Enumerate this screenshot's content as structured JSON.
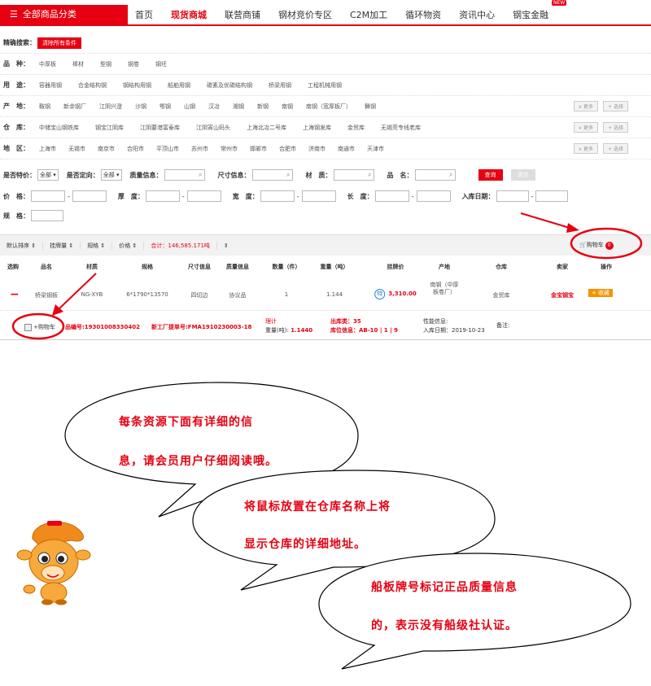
{
  "nav": {
    "category_label": "全部商品分类",
    "items": [
      "首页",
      "现货商城",
      "联营商铺",
      "钢材竞价专区",
      "C2M加工",
      "循环物资",
      "资讯中心",
      "钢宝金融"
    ],
    "active_index": 1,
    "new_badge": "NEW"
  },
  "filters": {
    "precise_search_label": "精确搜索：",
    "clear_label": "清除所有条件",
    "rows": [
      {
        "label": "品　种：",
        "first": "中厚板",
        "options": [
          "棒材",
          "型钢",
          "钢卷",
          "钢坯"
        ],
        "more": false
      },
      {
        "label": "用　途：",
        "first": "容器用钢",
        "options": [
          "合金结构钢",
          "钢结构用钢",
          "船舶用钢",
          "碳素及优碳结构钢",
          "桥梁用钢",
          "工程机械用钢"
        ],
        "more": false
      },
      {
        "label": "产　地：",
        "first": "鞍钢",
        "options": [
          "新余钢厂",
          "江阴兴澄",
          "沙钢",
          "鄂钢",
          "山钢",
          "汉冶",
          "湘钢",
          "新钢",
          "南钢",
          "南钢（宽厚板厂）",
          "舞钢"
        ],
        "more": true
      },
      {
        "label": "仓　库：",
        "first": "中储宝山钢铁库",
        "options": [
          "钢宝江阴库",
          "江阴要港富泰库",
          "江阴宵山码头",
          "上海北冶二号库",
          "上海钢发库",
          "金贸库",
          "无锡亮专线老库"
        ],
        "more": true
      },
      {
        "label": "地　区：",
        "first": "上海市",
        "options": [
          "无锡市",
          "南京市",
          "合阳市",
          "平顶山市",
          "苏州市",
          "常州市",
          "邯郸市",
          "合肥市",
          "济南市",
          "南通市",
          "天津市"
        ],
        "more": true
      }
    ],
    "more_label": "∨ 更多",
    "multi_label": "+ 选择"
  },
  "search": {
    "special_price_label": "是否特价：",
    "special_price_value": "全部",
    "directed_label": "是否定向：",
    "directed_value": "全部",
    "quality_label": "质量信息：",
    "size_label": "尺寸信息：",
    "material_label": "材　质：",
    "name_label": "品　名：",
    "query_label": "查询",
    "reset_label": "清空",
    "price_label": "价　格：",
    "thickness_label": "厚　度：",
    "width_label": "宽　度：",
    "length_label": "长　度：",
    "date_label": "入库日期：",
    "spec_label": "规　格："
  },
  "sort_bar": {
    "items": [
      "默认排序 ⇕",
      "挂牌量 ⇕",
      "规格 ⇕",
      "价格 ⇕"
    ],
    "total": "合计：146,585.171吨",
    "last": "⇕",
    "cart_label": "购物车",
    "cart_count": "0"
  },
  "table": {
    "headers": [
      "选购",
      "品名",
      "材质",
      "规格",
      "尺寸信息",
      "质量信息",
      "数量（件）",
      "重量（吨）",
      "挂牌价",
      "产地",
      "仓库",
      "卖家",
      "操作"
    ],
    "row": {
      "name": "桥梁钢板",
      "material": "NG-XYB",
      "spec": "6*1790*13570",
      "size_info": "四切边",
      "quality_info": "协议品",
      "qty": "1",
      "weight": "1.144",
      "price_badge": "特",
      "price": "3,310.00",
      "origin": "南钢（中厚板卷厂）",
      "warehouse": "金贸库",
      "seller": "金宝钢宝",
      "collect_label": "+ 收藏"
    },
    "detail": {
      "cart_label": "+购物车",
      "resource_no": "品编号:19301008330402",
      "factory_no": "新工厂提单号:FMA1910230003-18",
      "weigh_mode": "理计",
      "weight_label": "重量(吨):",
      "weight_value": "1.1440",
      "out_batch": "出库类：35",
      "location": "库位信息：AB-10 | 1 | 9",
      "perf_info": "性能信息:",
      "in_date": "入库日期：2019-10-23",
      "remark": "备注:"
    }
  },
  "bubbles": [
    {
      "line1": "每条资源下面有详细的信",
      "line2": "息，请会员用户仔细阅读哦。"
    },
    {
      "line1": "将鼠标放置在仓库名称上将",
      "line2": "显示仓库的详细地址。"
    },
    {
      "line1": "船板牌号标记正品质量信息",
      "line2": "的，表示没有船级社认证。"
    }
  ],
  "colors": {
    "brand_red": "#e60012",
    "annotation_red": "#e60012",
    "collect_orange": "#f29300"
  }
}
